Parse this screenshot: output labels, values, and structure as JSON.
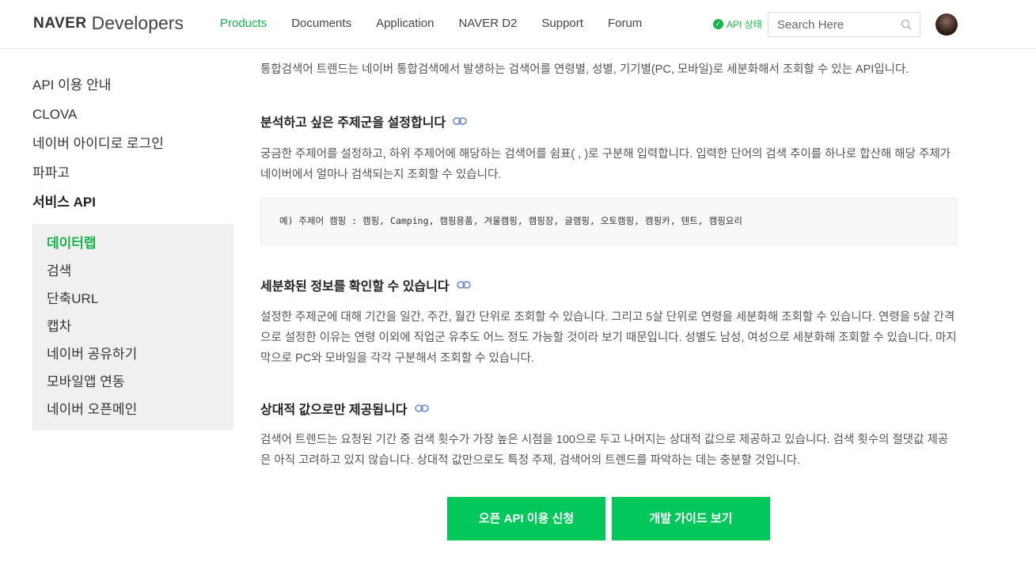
{
  "header": {
    "logo_brand": "NAVER",
    "logo_sub": "Developers",
    "nav": [
      "Products",
      "Documents",
      "Application",
      "NAVER D2",
      "Support",
      "Forum"
    ],
    "api_status": "API 상태",
    "search_placeholder": "Search Here"
  },
  "sidebar": {
    "items": [
      "API 이용 안내",
      "CLOVA",
      "네이버 아이디로 로그인",
      "파파고",
      "서비스 API"
    ],
    "sub_items": [
      "데이터랩",
      "검색",
      "단축URL",
      "캡차",
      "네이버 공유하기",
      "모바일앱 연동",
      "네이버 오픈메인"
    ]
  },
  "main": {
    "intro": "통합검색어 트렌드는 네이버 통합검색에서 발생하는 검색어를 연령별, 성별, 기기별(PC, 모바일)로 세분화해서 조회할 수 있는 API입니다.",
    "section1_title": "분석하고 싶은 주제군을 설정합니다",
    "section1_text": "궁금한 주제어를 설정하고, 하위 주제어에 해당하는 검색어를 쉼표( , )로 구분해 입력합니다. 입력한 단어의 검색 추이를 하나로 합산해 해당 주제가 네이버에서 얼마나 검색되는지 조회할 수 있습니다.",
    "code_example": "예) 주제어 캠핑 : 캠핑, Camping, 캠핑용품, 겨울캠핑, 캠핑장, 글램핑, 오토캠핑, 캠핑카, 텐트, 캠핑요리",
    "section2_title": "세분화된 정보를 확인할 수 있습니다",
    "section2_text": "설정한 주제군에 대해 기간을 일간, 주간, 월간 단위로 조회할 수 있습니다. 그리고 5살 단위로 연령을 세분화해 조회할 수 있습니다. 연령을 5살 간격으로 설정한 이유는 연령 이외에 직업군 유추도 어느 정도 가능할 것이라 보기 때문입니다. 성별도 남성, 여성으로 세분화해 조회할 수 있습니다. 마지막으로 PC와 모바일을 각각 구분해서 조회할 수 있습니다.",
    "section3_title": "상대적 값으로만 제공됩니다",
    "section3_text": "검색어 트렌드는 요청된 기간 중 검색 횟수가 가장 높은 시점을 100으로 두고 나머지는 상대적 값으로 제공하고 있습니다. 검색 횟수의 절댓값 제공은 아직 고려하고 있지 않습니다. 상대적 값만으로도 특정 주제, 검색어의 트렌드를 파악하는 데는 충분할 것입니다.",
    "btn_apply": "오픈 API 이용 신청",
    "btn_guide": "개발 가이드 보기"
  },
  "colors": {
    "accent": "#19b54a",
    "button": "#03c75a",
    "submenu_bg": "#f0f0f0"
  }
}
